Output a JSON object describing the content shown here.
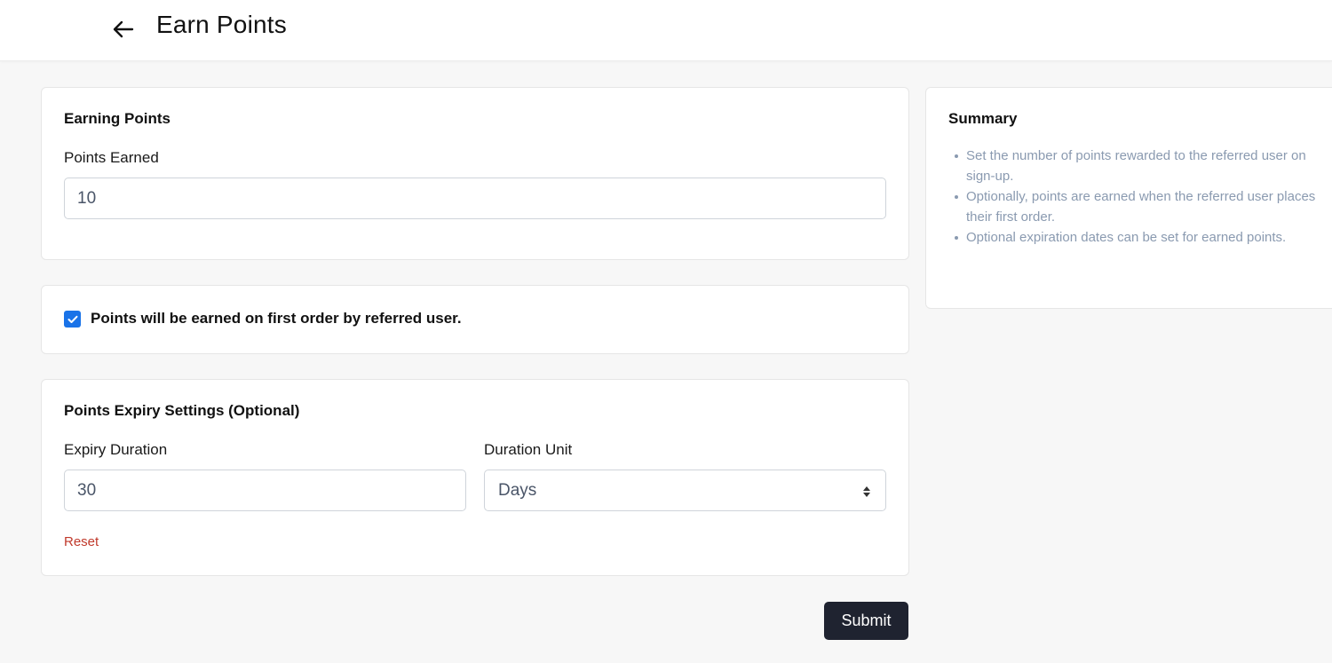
{
  "header": {
    "title": "Earn Points",
    "back_icon": "arrow-left-icon"
  },
  "earning": {
    "title": "Earning Points",
    "points_label": "Points Earned",
    "points_value": "10"
  },
  "first_order": {
    "checked": true,
    "label": "Points will be earned on first order by referred user."
  },
  "expiry": {
    "title": "Points Expiry Settings (Optional)",
    "duration_label": "Expiry Duration",
    "duration_value": "30",
    "unit_label": "Duration Unit",
    "unit_value": "Days",
    "reset_label": "Reset"
  },
  "actions": {
    "submit_label": "Submit"
  },
  "summary": {
    "title": "Summary",
    "items": [
      "Set the number of points rewarded to the referred user on sign-up.",
      "Optionally, points are earned when the referred user places their first order.",
      "Optional expiration dates can be set for earned points."
    ]
  },
  "colors": {
    "checkbox": "#1a73e8",
    "submit_bg": "#1f2330",
    "reset": "#c0392b",
    "summary_text": "#8a9ab0"
  }
}
